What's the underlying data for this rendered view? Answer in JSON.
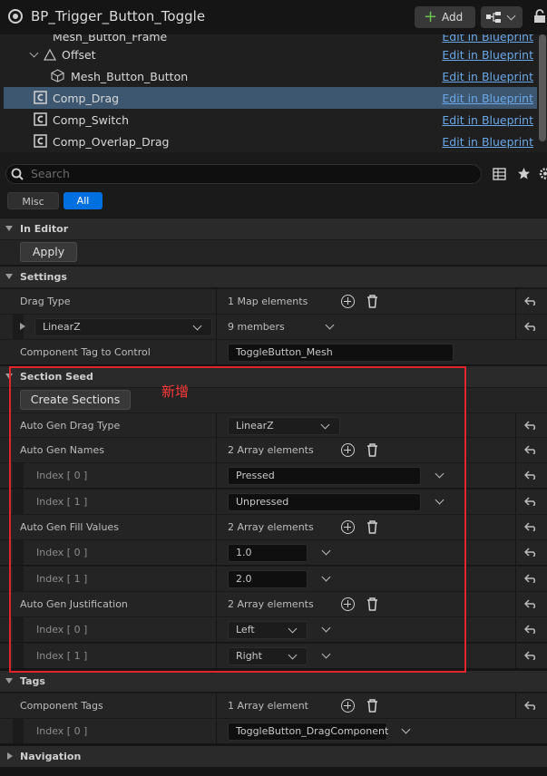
{
  "window": {
    "title": "BP_Trigger_Button_Toggle",
    "add_label": "Add"
  },
  "tree": {
    "rows": [
      {
        "label": "Mesh_Button_Frame",
        "link": "Edit in Blueprint"
      },
      {
        "label": "Offset",
        "link": "Edit in Blueprint"
      },
      {
        "label": "Mesh_Button_Button",
        "link": "Edit in Blueprint"
      },
      {
        "label": "Comp_Drag",
        "link": "Edit in Blueprint"
      },
      {
        "label": "Comp_Switch",
        "link": "Edit in Blueprint"
      },
      {
        "label": "Comp_Overlap_Drag",
        "link": "Edit in Blueprint"
      }
    ]
  },
  "search": {
    "placeholder": "Search"
  },
  "filters": {
    "misc": "Misc",
    "all": "All"
  },
  "details": {
    "in_editor": {
      "title": "In Editor",
      "apply": "Apply"
    },
    "settings": {
      "title": "Settings",
      "drag_type": {
        "label": "Drag Type",
        "value": "1 Map elements"
      },
      "map_key": "LinearZ",
      "map_value": "9 members",
      "tag_label": "Component Tag to Control",
      "tag_value": "ToggleButton_Mesh"
    },
    "section_seed": {
      "title": "Section Seed",
      "create": "Create Sections",
      "auto_drag_type": {
        "label": "Auto Gen Drag Type",
        "value": "LinearZ"
      },
      "names": {
        "label": "Auto Gen Names",
        "value": "2 Array elements",
        "items": [
          {
            "index": "Index [ 0 ]",
            "value": "Pressed"
          },
          {
            "index": "Index [ 1 ]",
            "value": "Unpressed"
          }
        ]
      },
      "fill_values": {
        "label": "Auto Gen Fill Values",
        "value": "2 Array elements",
        "items": [
          {
            "index": "Index [ 0 ]",
            "value": "1.0"
          },
          {
            "index": "Index [ 1 ]",
            "value": "2.0"
          }
        ]
      },
      "justification": {
        "label": "Auto Gen Justification",
        "value": "2 Array elements",
        "items": [
          {
            "index": "Index [ 0 ]",
            "value": "Left"
          },
          {
            "index": "Index [ 1 ]",
            "value": "Right"
          }
        ]
      }
    },
    "tags": {
      "title": "Tags",
      "component_tags": {
        "label": "Component Tags",
        "value": "1 Array element"
      },
      "items": [
        {
          "index": "Index [ 0 ]",
          "value": "ToggleButton_DragComponent"
        }
      ]
    },
    "navigation": {
      "title": "Navigation"
    }
  },
  "annotation": {
    "note": "新增"
  },
  "colors": {
    "accent": "#0070e0",
    "link": "#6aa7e8",
    "highlight_box": "#e0262b",
    "selected_row": "#3e5770"
  }
}
